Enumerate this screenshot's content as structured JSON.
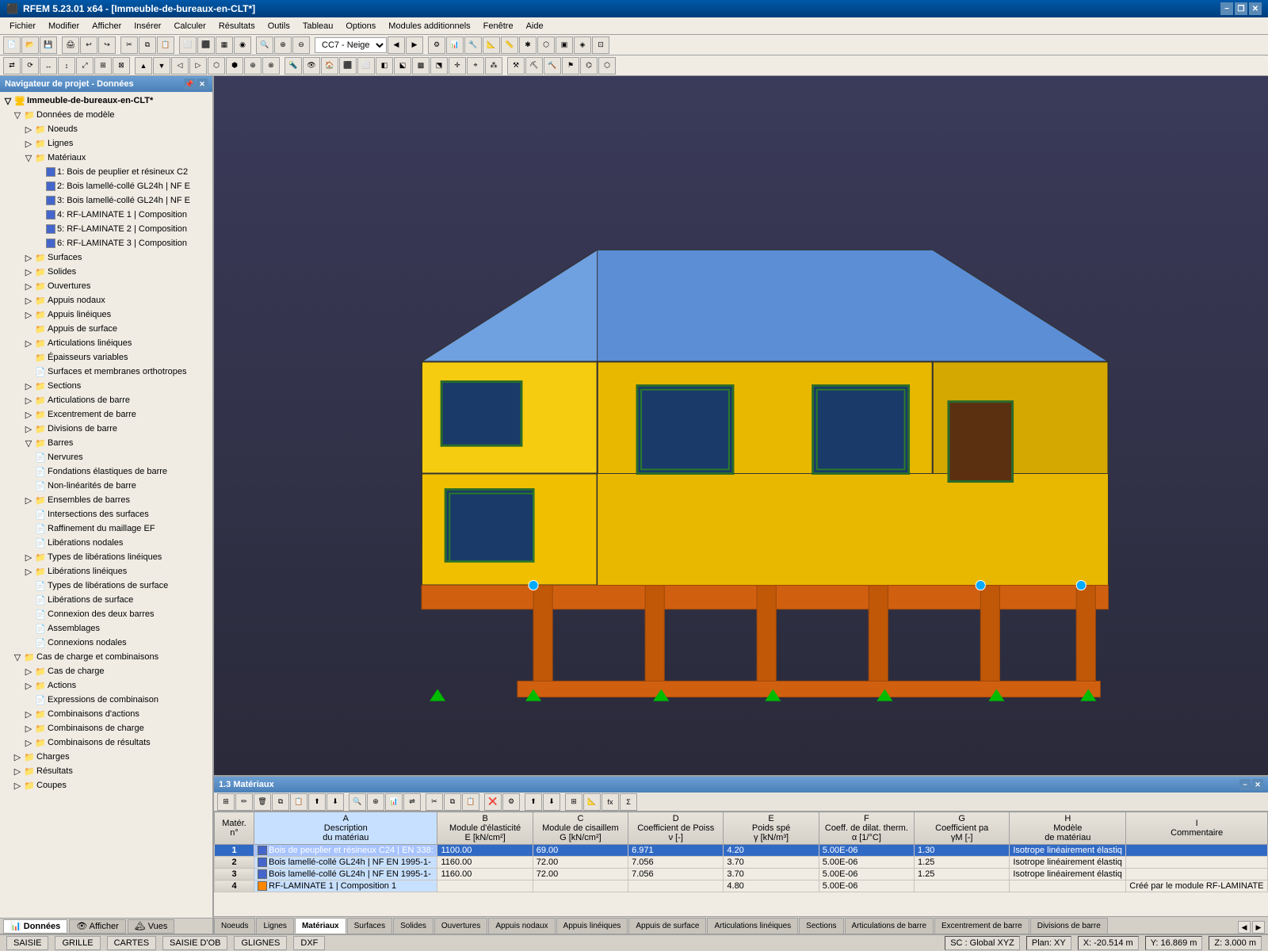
{
  "title_bar": {
    "title": "RFEM 5.23.01 x64 - [Immeuble-de-bureaux-en-CLT*]",
    "icon": "rfem-icon",
    "min_label": "−",
    "restore_label": "❐",
    "close_label": "✕",
    "inner_min": "−",
    "inner_restore": "❐",
    "inner_close": "✕"
  },
  "menu": {
    "items": [
      "Fichier",
      "Modifier",
      "Afficher",
      "Insérer",
      "Calculer",
      "Résultats",
      "Outils",
      "Tableau",
      "Options",
      "Modules additionnels",
      "Fenêtre",
      "Aide"
    ]
  },
  "toolbar": {
    "combo_label": "CC7 - Neige"
  },
  "left_panel": {
    "title": "Navigateur de projet - Données",
    "root": "Immeuble-de-bureaux-en-CLT*",
    "items": [
      {
        "id": "donnees_modele",
        "label": "Données de modèle",
        "level": 1,
        "type": "folder",
        "expanded": true
      },
      {
        "id": "noeuds",
        "label": "Noeuds",
        "level": 2,
        "type": "folder",
        "expanded": false
      },
      {
        "id": "lignes",
        "label": "Lignes",
        "level": 2,
        "type": "folder",
        "expanded": false
      },
      {
        "id": "materiaux",
        "label": "Matériaux",
        "level": 2,
        "type": "folder",
        "expanded": true
      },
      {
        "id": "mat1",
        "label": "1: Bois de peuplier et résineux C2",
        "level": 3,
        "type": "material",
        "color": "#4444cc"
      },
      {
        "id": "mat2",
        "label": "2: Bois lamellé-collé GL24h | NF E",
        "level": 3,
        "type": "material",
        "color": "#4444cc"
      },
      {
        "id": "mat3",
        "label": "3: Bois lamellé-collé GL24h | NF E",
        "level": 3,
        "type": "material",
        "color": "#4444cc"
      },
      {
        "id": "mat4",
        "label": "4: RF-LAMINATE 1 | Composition",
        "level": 3,
        "type": "material",
        "color": "#4444cc"
      },
      {
        "id": "mat5",
        "label": "5: RF-LAMINATE 2 | Composition",
        "level": 3,
        "type": "material",
        "color": "#4444cc"
      },
      {
        "id": "mat6",
        "label": "6: RF-LAMINATE 3 | Composition",
        "level": 3,
        "type": "material",
        "color": "#4444cc"
      },
      {
        "id": "surfaces",
        "label": "Surfaces",
        "level": 2,
        "type": "folder",
        "expanded": false
      },
      {
        "id": "solides",
        "label": "Solides",
        "level": 2,
        "type": "folder",
        "expanded": false
      },
      {
        "id": "ouvertures",
        "label": "Ouvertures",
        "level": 2,
        "type": "folder",
        "expanded": false
      },
      {
        "id": "appuis_nodaux",
        "label": "Appuis nodaux",
        "level": 2,
        "type": "folder",
        "expanded": false
      },
      {
        "id": "appuis_lineaires",
        "label": "Appuis linéiques",
        "level": 2,
        "type": "folder",
        "expanded": false
      },
      {
        "id": "appuis_surface",
        "label": "Appuis de surface",
        "level": 2,
        "type": "folder",
        "expanded": false
      },
      {
        "id": "articulations_lineaires",
        "label": "Articulations linéiques",
        "level": 2,
        "type": "folder",
        "expanded": false
      },
      {
        "id": "epaisseurs",
        "label": "Épaisseurs variables",
        "level": 2,
        "type": "leaf"
      },
      {
        "id": "surfaces_membranes",
        "label": "Surfaces et membranes orthotropes",
        "level": 2,
        "type": "leaf"
      },
      {
        "id": "sections",
        "label": "Sections",
        "level": 2,
        "type": "folder",
        "expanded": false
      },
      {
        "id": "articulations_barre",
        "label": "Articulations de barre",
        "level": 2,
        "type": "folder",
        "expanded": false
      },
      {
        "id": "excentrement",
        "label": "Excentrement de barre",
        "level": 2,
        "type": "folder",
        "expanded": false
      },
      {
        "id": "divisions_barre",
        "label": "Divisions de barre",
        "level": 2,
        "type": "folder",
        "expanded": false
      },
      {
        "id": "barres",
        "label": "Barres",
        "level": 2,
        "type": "folder",
        "expanded": true
      },
      {
        "id": "nervures",
        "label": "Nervures",
        "level": 2,
        "type": "leaf"
      },
      {
        "id": "fondations",
        "label": "Fondations élastiques de barre",
        "level": 2,
        "type": "leaf"
      },
      {
        "id": "non_linearites",
        "label": "Non-linéarités de barre",
        "level": 2,
        "type": "leaf"
      },
      {
        "id": "ensembles_barres",
        "label": "Ensembles de barres",
        "level": 2,
        "type": "folder",
        "expanded": false
      },
      {
        "id": "intersections",
        "label": "Intersections des surfaces",
        "level": 2,
        "type": "leaf"
      },
      {
        "id": "raffinement",
        "label": "Raffinement du maillage EF",
        "level": 2,
        "type": "leaf"
      },
      {
        "id": "liberations_nodales",
        "label": "Libérations nodales",
        "level": 2,
        "type": "leaf"
      },
      {
        "id": "types_liberations_lineaires",
        "label": "Types de libérations linéiques",
        "level": 2,
        "type": "folder",
        "expanded": false
      },
      {
        "id": "liberations_lineaires",
        "label": "Libérations linéiques",
        "level": 2,
        "type": "folder",
        "expanded": false
      },
      {
        "id": "types_liberations_surface",
        "label": "Types de libérations de surface",
        "level": 2,
        "type": "leaf"
      },
      {
        "id": "liberations_surface",
        "label": "Libérations de surface",
        "level": 2,
        "type": "leaf"
      },
      {
        "id": "connexion_deux_barres",
        "label": "Connexion des deux barres",
        "level": 2,
        "type": "leaf"
      },
      {
        "id": "assemblages",
        "label": "Assemblages",
        "level": 2,
        "type": "leaf"
      },
      {
        "id": "connexions_nodales",
        "label": "Connexions nodales",
        "level": 2,
        "type": "leaf"
      },
      {
        "id": "cas_charge_combinaisons",
        "label": "Cas de charge et combinaisons",
        "level": 1,
        "type": "folder",
        "expanded": true
      },
      {
        "id": "cas_charge",
        "label": "Cas de charge",
        "level": 2,
        "type": "folder",
        "expanded": false
      },
      {
        "id": "actions",
        "label": "Actions",
        "level": 2,
        "type": "folder",
        "expanded": false
      },
      {
        "id": "expressions_combinaison",
        "label": "Expressions de combinaison",
        "level": 2,
        "type": "leaf"
      },
      {
        "id": "combinaisons_actions",
        "label": "Combinaisons d'actions",
        "level": 2,
        "type": "folder",
        "expanded": false
      },
      {
        "id": "combinaisons_charge",
        "label": "Combinaisons de charge",
        "level": 2,
        "type": "folder",
        "expanded": false
      },
      {
        "id": "combinaisons_resultats",
        "label": "Combinaisons de résultats",
        "level": 2,
        "type": "folder",
        "expanded": false
      },
      {
        "id": "charges",
        "label": "Charges",
        "level": 1,
        "type": "folder",
        "expanded": false
      },
      {
        "id": "resultats",
        "label": "Résultats",
        "level": 1,
        "type": "folder",
        "expanded": false
      },
      {
        "id": "coupes",
        "label": "Coupes",
        "level": 1,
        "type": "folder",
        "expanded": false
      }
    ],
    "bottom_tabs": [
      {
        "id": "donnees",
        "label": "Données",
        "active": true
      },
      {
        "id": "afficher",
        "label": "Afficher"
      },
      {
        "id": "vues",
        "label": "Vues"
      }
    ]
  },
  "data_panel": {
    "title": "1.3 Matériaux",
    "columns": [
      {
        "id": "matr",
        "label": "Matér.\nn°"
      },
      {
        "id": "a",
        "label": "A\nDescription\ndu matériau"
      },
      {
        "id": "b",
        "label": "B\nModule d'élasticité\nE [kN/cm²]"
      },
      {
        "id": "c",
        "label": "C\nModule de cisaillem\nG [kN/cm²]"
      },
      {
        "id": "d",
        "label": "D\nCoefficient de Poiss\nν [-]"
      },
      {
        "id": "e",
        "label": "E\nPoids spé\nγ [kN/m³]"
      },
      {
        "id": "f",
        "label": "F\nCoeff. de dilat. therm.\nα [1/°C]"
      },
      {
        "id": "g",
        "label": "G\nCoefficient pa\nγM [-]"
      },
      {
        "id": "h",
        "label": "H\nModèle\nde matériau"
      },
      {
        "id": "i",
        "label": "I\nCommentaire"
      }
    ],
    "rows": [
      {
        "num": "1",
        "selected": true,
        "color": "#4488ff",
        "desc": "Bois de peuplier et résineux C24 | EN 338:",
        "E": "1100.00",
        "G": "69.00",
        "nu": "6.971",
        "gamma": "4.20",
        "alpha": "5.00E-06",
        "gammaM": "1.30",
        "modele": "Isotrope linéairement élastiq",
        "comment": ""
      },
      {
        "num": "2",
        "selected": false,
        "color": "#4488ff",
        "desc": "Bois lamellé-collé GL24h | NF EN 1995-1-",
        "E": "1160.00",
        "G": "72.00",
        "nu": "7.056",
        "gamma": "3.70",
        "alpha": "5.00E-06",
        "gammaM": "1.25",
        "modele": "Isotrope linéairement élastiq",
        "comment": ""
      },
      {
        "num": "3",
        "selected": false,
        "color": "#4488ff",
        "desc": "Bois lamellé-collé GL24h | NF EN 1995-1-",
        "E": "1160.00",
        "G": "72.00",
        "nu": "7.056",
        "gamma": "3.70",
        "alpha": "5.00E-06",
        "gammaM": "1.25",
        "modele": "Isotrope linéairement élastiq",
        "comment": ""
      },
      {
        "num": "4",
        "selected": false,
        "color": "#ff8800",
        "desc": "RF-LAMINATE 1 | Composition 1",
        "E": "",
        "G": "",
        "nu": "",
        "gamma": "4.80",
        "alpha": "5.00E-06",
        "gammaM": "",
        "modele": "",
        "comment": "Créé par le module RF-LAMINATE"
      }
    ]
  },
  "bottom_tabs": [
    {
      "id": "noeuds",
      "label": "Noeuds"
    },
    {
      "id": "lignes",
      "label": "Lignes"
    },
    {
      "id": "materiaux",
      "label": "Matériaux",
      "active": true
    },
    {
      "id": "surfaces",
      "label": "Surfaces"
    },
    {
      "id": "solides",
      "label": "Solides"
    },
    {
      "id": "ouvertures",
      "label": "Ouvertures"
    },
    {
      "id": "appuis_nodaux",
      "label": "Appuis nodaux"
    },
    {
      "id": "appuis_lineaires",
      "label": "Appuis linéiques"
    },
    {
      "id": "appuis_surface",
      "label": "Appuis de surface"
    },
    {
      "id": "articulations_lineaires",
      "label": "Articulations linéiques"
    },
    {
      "id": "sections",
      "label": "Sections"
    },
    {
      "id": "articulations_barre",
      "label": "Articulations de barre"
    },
    {
      "id": "excentrement_barre",
      "label": "Excentrement de barre"
    },
    {
      "id": "divisions_barre",
      "label": "Divisions de barre"
    }
  ],
  "status_bar": {
    "saisie": "SAISIE",
    "grille": "GRILLE",
    "cartes": "CARTES",
    "saisie_ob": "SAISIE D'OB",
    "glignes": "GLIGNES",
    "dxf": "DXF",
    "sc": "SC : Global XYZ",
    "plan": "Plan: XY",
    "x": "X: -20.514 m",
    "y": "Y: 16.869 m",
    "z": "Z: 3.000 m"
  }
}
